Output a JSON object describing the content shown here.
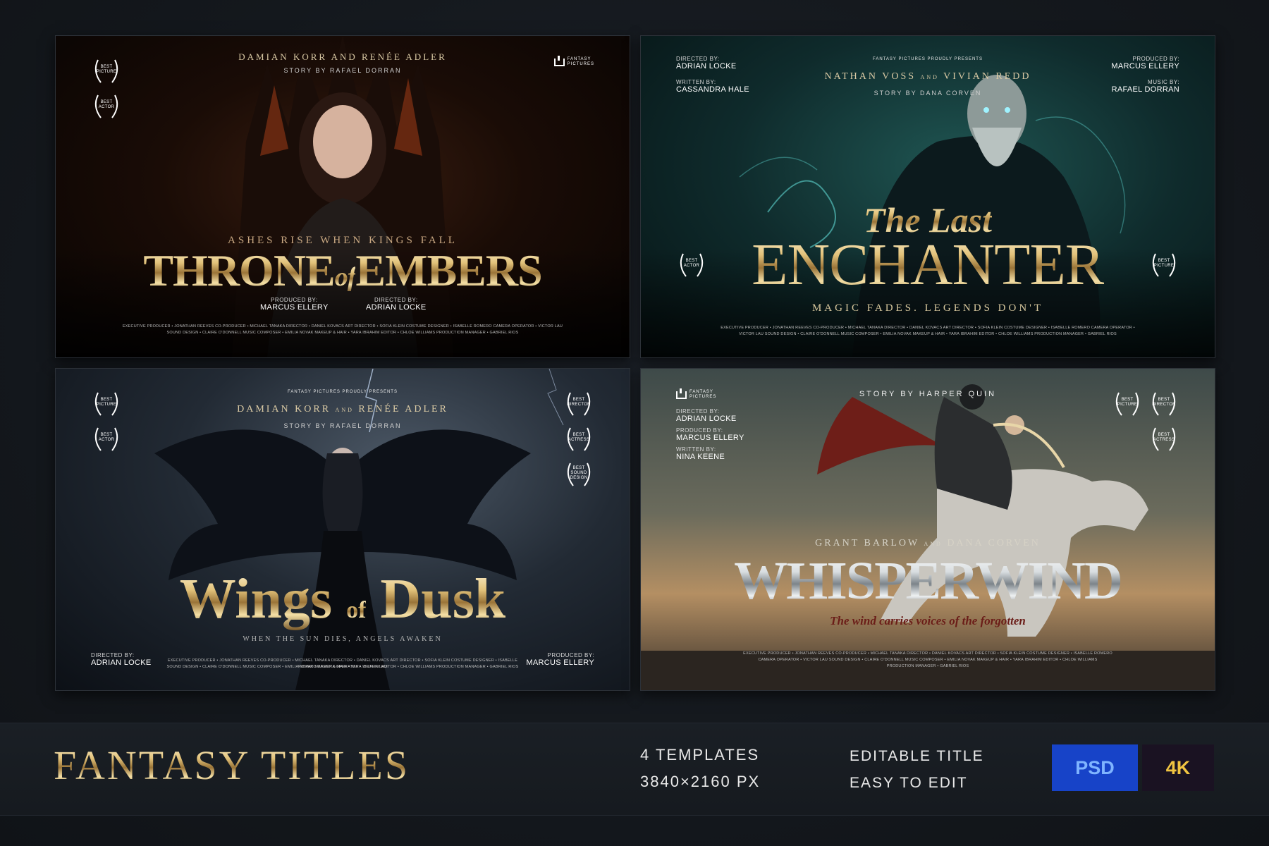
{
  "posters": [
    {
      "top_names": "DAMIAN KORR AND RENÉE ADLER",
      "story": "STORY BY RAFAEL DORRAN",
      "logo": [
        "FANTASY",
        "PICTURES"
      ],
      "laurels": [
        [
          "BEST",
          "PICTURE"
        ],
        [
          "BEST",
          "ACTOR"
        ]
      ],
      "tagline": "ASHES RISE WHEN KINGS FALL",
      "title_a": "THRONE",
      "title_of": "of",
      "title_b": "EMBERS",
      "credit1_role": "PRODUCED BY:",
      "credit1_name": "MARCUS ELLERY",
      "credit2_role": "DIRECTED BY:",
      "credit2_name": "ADRIAN LOCKE",
      "fine_1": "EXECUTIVE PRODUCER • JONATHAN REEVES    CO-PRODUCER • MICHAEL TANAKA    DIRECTOR • DANIEL KOVACS    ART DIRECTOR • SOFIA KLEIN    COSTUME DESIGNER • ISABELLE ROMERO    CAMERA OPERATOR • VICTOR LAU",
      "fine_2": "SOUND DESIGN • CLAIRE O'DONNELL    MUSIC COMPOSER • EMILIA NOVAK    MAKEUP & HAIR • YARA IBRAHIM    EDITOR • CHLOE WILLIAMS    PRODUCTION MANAGER • GABRIEL RIOS"
    },
    {
      "logo_line": "FANTASY PICTURES PROUDLY PRESENTS",
      "top_names_a": "NATHAN VOSS",
      "top_and": "AND",
      "top_names_b": "VIVIAN REDD",
      "story": "STORY BY DANA CORVEN",
      "left_credits": [
        [
          "DIRECTED BY:",
          "ADRIAN LOCKE"
        ],
        [
          "WRITTEN BY:",
          "CASSANDRA HALE"
        ]
      ],
      "right_credits": [
        [
          "PRODUCED BY:",
          "MARCUS ELLERY"
        ],
        [
          "MUSIC BY:",
          "RAFAEL DORRAN"
        ]
      ],
      "laurel_left": [
        "BEST",
        "ACTOR"
      ],
      "laurel_right": [
        "BEST",
        "PICTURE"
      ],
      "title_script": "The Last",
      "title_main": "ENCHANTER",
      "tagline": "MAGIC FADES. LEGENDS DON'T",
      "fine_1": "EXECUTIVE PRODUCER • JONATHAN REEVES    CO-PRODUCER • MICHAEL TANAKA    DIRECTOR • DANIEL KOVACS    ART DIRECTOR • SOFIA KLEIN    COSTUME DESIGNER • ISABELLE ROMERO    CAMERA OPERATOR •",
      "fine_2": "VICTOR LAU    SOUND DESIGN • CLAIRE O'DONNELL    MUSIC COMPOSER • EMILIA NOVAK    MAKEUP & HAIR • YARA IBRAHIM    EDITOR • CHLOE WILLIAMS    PRODUCTION MANAGER • GABRIEL RIOS"
    },
    {
      "logo_line": "FANTASY PICTURES PROUDLY PRESENTS",
      "top_names_a": "DAMIAN KORR",
      "top_and": "AND",
      "top_names_b": "RENÉE ADLER",
      "story": "STORY BY RAFAEL DORRAN",
      "laurels_left": [
        [
          "BEST",
          "PICTURE"
        ],
        [
          "BEST",
          "ACTOR"
        ]
      ],
      "laurels_right": [
        [
          "BEST",
          "DIRECTOR"
        ],
        [
          "BEST",
          "ACTRESS"
        ],
        [
          "BEST",
          "SOUND",
          "DESIGN"
        ]
      ],
      "title_a": "Wings",
      "title_of": "of",
      "title_b": "Dusk",
      "tagline": "WHEN THE SUN DIES, ANGELS AWAKEN",
      "credit_left_role": "DIRECTED BY:",
      "credit_left_name": "ADRIAN LOCKE",
      "credit_right_role": "PRODUCED BY:",
      "credit_right_name": "MARCUS ELLERY",
      "fine_1": "EXECUTIVE PRODUCER • JONATHAN REEVES    CO-PRODUCER • MICHAEL TANAKA    DIRECTOR • DANIEL KOVACS    ART DIRECTOR • SOFIA KLEIN    COSTUME DESIGNER • ISABELLE ROMERO    CAMERA OPERATOR • VICTOR LAU",
      "fine_2": "SOUND DESIGN • CLAIRE O'DONNELL    MUSIC COMPOSER • EMILIA NOVAK    MAKEUP & HAIR • YARA IBRAHIM    EDITOR • CHLOE WILLIAMS    PRODUCTION MANAGER • GABRIEL RIOS"
    },
    {
      "logo": [
        "FANTASY",
        "PICTURES"
      ],
      "story": "STORY BY HARPER QUIN",
      "left_credits": [
        [
          "DIRECTED BY:",
          "ADRIAN LOCKE"
        ],
        [
          "PRODUCED BY:",
          "MARCUS ELLERY"
        ],
        [
          "WRITTEN BY:",
          "NINA KEENE"
        ]
      ],
      "laurels_right": [
        [
          "BEST",
          "PICTURE"
        ],
        [
          "BEST",
          "DIRECTOR"
        ],
        [
          "BEST",
          "ACTRESS"
        ]
      ],
      "top_names_a": "GRANT BARLOW",
      "top_and": "AND",
      "top_names_b": "DANA CORVEN",
      "title_main": "WHISPERWIND",
      "tagline": "The wind carries voices of the forgotten",
      "fine_1": "EXECUTIVE PRODUCER • JONATHAN REEVES    CO-PRODUCER • MICHAEL TANAKA    DIRECTOR • DANIEL KOVACS    ART DIRECTOR • SOFIA KLEIN    COSTUME DESIGNER • ISABELLE ROMERO",
      "fine_2": "CAMERA OPERATOR • VICTOR LAU    SOUND DESIGN • CLAIRE O'DONNELL    MUSIC COMPOSER • EMILIA NOVAK    MAKEUP & HAIR • YARA IBRAHIM    EDITOR • CHLOE WILLIAMS",
      "fine_3": "PRODUCTION MANAGER • GABRIEL RIOS"
    }
  ],
  "footer": {
    "brand": "FANTASY TITLES",
    "feature1_line1": "4 TEMPLATES",
    "feature1_line2": "3840×2160 PX",
    "feature2_line1": "EDITABLE TITLE",
    "feature2_line2": "EASY TO EDIT",
    "badge_psd": "PSD",
    "badge_4k": "4K"
  },
  "colors": {
    "psd_badge": "#1743c8",
    "psd_text": "#7fb4ff",
    "k4_badge": "#1a1222",
    "k4_text": "#f1c441"
  }
}
